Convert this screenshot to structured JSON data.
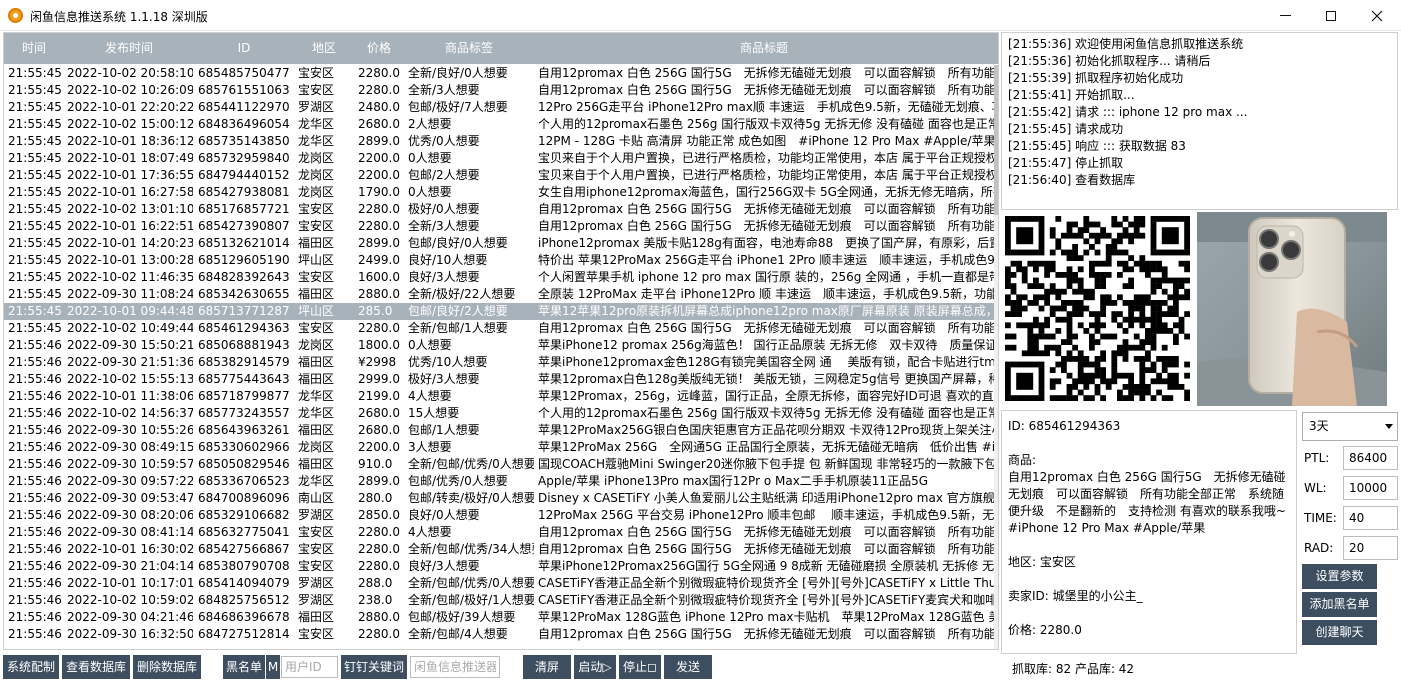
{
  "window": {
    "title": "闲鱼信息推送系统 1.1.18 深圳版"
  },
  "table": {
    "columns": [
      "时间",
      "发布时间",
      "ID",
      "地区",
      "价格",
      "商品标签",
      "商品标题"
    ],
    "selected_index": 14,
    "rows": [
      [
        "21:55:45",
        "2022-10-02 20:58:10",
        "685485750477",
        "宝安区",
        "2280.0",
        "全新/良好/0人想要",
        "自用12promax 白色 256G 国行5G　无拆修无磕碰无划痕　可以面容解锁　所有功能全部正常"
      ],
      [
        "21:55:45",
        "2022-10-02 10:26:09",
        "685761551063",
        "宝安区",
        "2280.0",
        "全新/3人想要",
        "自用12promax 白色 256G 国行5G　无拆修无磕碰无划痕　可以面容解锁　所有功能全部正常"
      ],
      [
        "21:55:45",
        "2022-10-01 22:20:22",
        "685441122970",
        "罗湖区",
        "2480.0",
        "包邮/极好/7人想要",
        "12Pro 256G走平台 iPhone12Pro max顺 丰速运　手机成色9.5新，无磕碰无划痕、功能正常"
      ],
      [
        "21:55:45",
        "2022-10-02 15:00:12",
        "684836496054",
        "龙华区",
        "2680.0",
        "2人想要",
        "个人用的12promax石墨色 256g 国行版双卡双待5g 无拆无修 没有磕碰 面容也是正常的"
      ],
      [
        "21:55:45",
        "2022-10-01 18:36:12",
        "685735143850",
        "龙华区",
        "2899.0",
        "优秀/0人想要",
        "12PM - 128G 卡贴 高清屏 功能正常 成色如图　#iPhone 12 Pro Max #Apple/苹果"
      ],
      [
        "21:55:45",
        "2022-10-01 18:07:49",
        "685732959840",
        "龙岗区",
        "2200.0",
        "0人想要",
        "宝贝来自于个人用户置换，已进行严格质检，功能均正常使用，本店 属于平台正规授权回收商"
      ],
      [
        "21:55:45",
        "2022-10-01 17:36:55",
        "684794440152",
        "龙岗区",
        "2200.0",
        "包邮/2人想要",
        "宝贝来自于个人用户置换，已进行严格质检，功能均正常使用，本店 属于平台正规授权回收商"
      ],
      [
        "21:55:45",
        "2022-10-01 16:27:58",
        "685427938081",
        "龙岗区",
        "1790.0",
        "0人想要",
        "女生自用iphone12promax海蓝色，国行256G双卡 5G全网通，无拆无修无暗病，所有功能正常"
      ],
      [
        "21:55:45",
        "2022-10-02 13:01:10",
        "685176857721",
        "宝安区",
        "2280.0",
        "极好/0人想要",
        "自用12promax 白色 256G 国行5G　无拆修无磕碰无划痕　可以面容解锁　所有功能全部正常"
      ],
      [
        "21:55:45",
        "2022-10-01 16:22:51",
        "685427390807",
        "宝安区",
        "2280.0",
        "全新/3人想要",
        "自用12promax 白色 256G 国行5G　无拆修无磕碰无划痕　可以面容解锁　所有功能全部正常"
      ],
      [
        "21:55:45",
        "2022-10-01 14:20:23",
        "685132621014",
        "福田区",
        "2899.0",
        "包邮/良好/0人想要",
        "iPhone12promax 美版卡贴128g有面容，电池寿命88　更换了国产屏，有原彩，后置摄像头"
      ],
      [
        "21:55:45",
        "2022-10-01 13:00:28",
        "685129605190",
        "坪山区",
        "2499.0",
        "良好/10人想要",
        "特价出 苹果12ProMax 256G走平台 iPhone1 2Pro 顺丰速运　顺丰速运，手机成色9.5新"
      ],
      [
        "21:55:45",
        "2022-10-02 11:46:35",
        "684828392643",
        "宝安区",
        "1600.0",
        "良好/3人想要",
        "个人闲置苹果手机 iphone 12 pro max 国行原 装的，256g 全网通 ，手机一直都是带壳"
      ],
      [
        "21:55:45",
        "2022-09-30 11:08:24",
        "685342630655",
        "福田区",
        "2880.0",
        "全新/极好/22人想要",
        "全原装 12ProMax 走平台 iPhone12Pro 顺 丰速运　顺丰速运，手机成色9.5新，功能完好"
      ],
      [
        "21:55:45",
        "2022-10-01 09:44:48",
        "685713771287",
        "坪山区",
        "285.0",
        "包邮/良好/2人想要",
        "苹果12苹果12pro原装拆机屏幕总成iphone12pro max原厂屏幕原装 原装屏幕总成，无修"
      ],
      [
        "21:55:45",
        "2022-10-02 10:49:44",
        "685461294363",
        "宝安区",
        "2280.0",
        "全新/包邮/1人想要",
        "自用12promax 白色 256G 国行5G　无拆修无磕碰无划痕　可以面容解锁　所有功能全部正常"
      ],
      [
        "21:55:46",
        "2022-09-30 15:50:21",
        "685068881943",
        "龙岗区",
        "1800.0",
        "0人想要",
        "苹果iPhone12 promax 256g海蓝色！ 国行正品原装 无拆无修　双卡双待　质量保证　电池"
      ],
      [
        "21:55:46",
        "2022-09-30 21:51:36",
        "685382914579",
        "福田区",
        "¥2998",
        "优秀/10人想要",
        "苹果iPhone12promax金色128G有锁完美国容全网 通　 美版有锁，配合卡贴进行tmsi设置"
      ],
      [
        "21:55:46",
        "2022-10-02 15:55:13",
        "685775443643",
        "福田区",
        "2999.0",
        "极好/3人想要",
        "苹果12promax白色128g美版纯无锁！ 美版无锁，三网稳定5g信号 更换国产屏幕，稀有颜色"
      ],
      [
        "21:55:46",
        "2022-10-01 11:38:06",
        "685718799877",
        "龙华区",
        "2199.0",
        "4人想要",
        "苹果12Promax，256g，远峰蓝，国行正品，全原无拆修，面容完好ID可退 喜欢的直接拍"
      ],
      [
        "21:55:46",
        "2022-10-02 14:56:37",
        "685773243557",
        "龙华区",
        "2680.0",
        "15人想要",
        "个人用的12promax石墨色 256g 国行版双卡双待5g 无拆无修 没有磕碰 面容也是正常的"
      ],
      [
        "21:55:46",
        "2022-09-30 10:55:26",
        "685643963261",
        "福田区",
        "2680.0",
        "包邮/1人想要",
        "苹果12ProMax256G银白色国庆钜惠官方正品花呗分期双 卡双待12Pro现货上架关注小店"
      ],
      [
        "21:55:46",
        "2022-09-30 08:49:15",
        "685330602966",
        "龙岗区",
        "2200.0",
        "3人想要",
        "苹果12ProMax 256G　全网通5G 正品国行全原装，无拆无磕碰无暗病　低价出售 #iPhone"
      ],
      [
        "21:55:46",
        "2022-09-30 10:59:57",
        "685050829546",
        "福田区",
        "910.0",
        "全新/包邮/优秀/0人想要",
        "国现COACH蔻驰Mini Swinger20迷你腋下包手提 包 新鲜国现 非常轻巧的一款腋下包"
      ],
      [
        "21:55:46",
        "2022-09-30 09:57:22",
        "685336706523",
        "龙华区",
        "2899.0",
        "包邮/优秀/0人想要",
        "Apple/苹果 iPhone13Pro max国行12Pr o Max二手手机原装11正品5G"
      ],
      [
        "21:55:46",
        "2022-09-30 09:53:47",
        "684700896096",
        "南山区",
        "280.0",
        "包邮/转卖/极好/0人想要",
        "Disney x CASETiFY 小美人鱼爱丽儿公主贴纸满 印适用iPhone12pro max 官方旗舰店"
      ],
      [
        "21:55:46",
        "2022-09-30 08:20:06",
        "685329106682",
        "罗湖区",
        "2850.0",
        "良好/0人想要",
        "12ProMax 256G 平台交易 iPhone12Pro 顺丰包邮　 顺丰速运，手机成色9.5新，无磕碰"
      ],
      [
        "21:55:46",
        "2022-09-30 08:41:14",
        "685632775041",
        "宝安区",
        "2280.0",
        "4人想要",
        "自用12promax 白色 256G 国行5G　无拆修无磕碰无划痕　可以面容解锁　所有功能全部正常"
      ],
      [
        "21:55:46",
        "2022-10-01 16:30:02",
        "685427566867",
        "宝安区",
        "2280.0",
        "全新/包邮/优秀/34人想要",
        "自用12promax 白色 256G 国行5G　无拆修无磕碰无划痕　可以面容解锁　所有功能全部正常"
      ],
      [
        "21:55:46",
        "2022-09-30 21:04:14",
        "685380790708",
        "宝安区",
        "2280.0",
        "良好/3人想要",
        "苹果iPhone12Promax256G国行 5G全网通 9 8成新 无磕碰磨损 全原装机 无拆修 无维修"
      ],
      [
        "21:55:46",
        "2022-10-01 10:17:01",
        "685414094079",
        "罗湖区",
        "288.0",
        "全新/包邮/优秀/0人想要",
        "CASETiFY香港正品全新个别微瑕疵特价现货齐全 [号外][号外]CASETiFY x Little Thunder"
      ],
      [
        "21:55:46",
        "2022-10-02 10:59:02",
        "684825756512",
        "罗湖区",
        "238.0",
        "全新/包邮/极好/1人想要",
        "CASETiFY香港正品全新个别微瑕疵特价现货齐全 [号外][号外]CASETiFY麦宾犬和咖啡杯"
      ],
      [
        "21:55:46",
        "2022-09-30 04:21:46",
        "684686396678",
        "福田区",
        "2880.0",
        "包邮/极好/39人想要",
        "苹果12ProMax 128G蓝色 iPhone 12Pro max卡贴机　苹果12ProMax 128G蓝色 美版卡贴"
      ],
      [
        "21:55:46",
        "2022-09-30 16:32:50",
        "684727512814",
        "宝安区",
        "2280.0",
        "全新/包邮/4人想要",
        "自用12promax 白色 256G 国行5G　无拆修无磕碰无划痕　可以面容解锁　所有功能全部正常"
      ]
    ]
  },
  "bottom": {
    "system_config": "系统配制",
    "view_db": "查看数据库",
    "delete_db": "删除数据库",
    "blacklist": "黑名单",
    "m_label": "M",
    "user_id_placeholder": "用户ID",
    "dingtalk_keyword": "钉钉关键词",
    "pusher_placeholder": "闲鱼信息推送器",
    "clear_screen": "清屏",
    "start": "启动▷",
    "stop": "停止◻",
    "send": "发送"
  },
  "log": [
    "[21:55:36]  欢迎使用闲鱼信息抓取推送系统",
    "[21:55:36]  初始化抓取程序... 请稍后",
    "[21:55:39]  抓取程序初始化成功",
    "[21:55:41]  开始抓取...",
    "[21:55:42]  请求 ::: iphone 12 pro max ...",
    "[21:55:45]  请求成功",
    "[21:55:45]  响应 ::: 获取数据 83",
    "[21:55:47]  停止抓取",
    "[21:56:40]  查看数据库"
  ],
  "detail": {
    "id_line": "ID: 685461294363",
    "goods_label": "商品:",
    "goods_text": "自用12promax 白色 256G 国行5G　无拆修无磕碰无划痕　可以面容解锁　所有功能全部正常　系统随便升级　不是翻新的　支持检测 有喜欢的联系我哦~ #iPhone 12 Pro Max #Apple/苹果",
    "region_line": "地区: 宝安区",
    "seller_line": "卖家ID: 城堡里的小公主_",
    "price_line": "价格: 2280.0"
  },
  "params": {
    "days_selected": "3天",
    "ptl_label": "PTL:",
    "ptl_value": "86400",
    "wl_label": "WL:",
    "wl_value": "10000",
    "time_label": "TIME:",
    "time_value": "40",
    "rad_label": "RAD:",
    "rad_value": "20",
    "set_params": "设置参数",
    "add_blacklist": "添加黑名单",
    "create_chat": "创建聊天"
  },
  "status": {
    "text": "抓取库:  82    产品库:  42"
  },
  "colors": {
    "header_bg": "#a8b2ba",
    "button_bg": "#3c4e60",
    "selected_row": "#a8b2ba"
  },
  "icons": {
    "app": "app-logo-icon",
    "minimize": "minimize-icon",
    "maximize": "maximize-icon",
    "close": "close-icon",
    "qr": "qr-code-icon"
  }
}
